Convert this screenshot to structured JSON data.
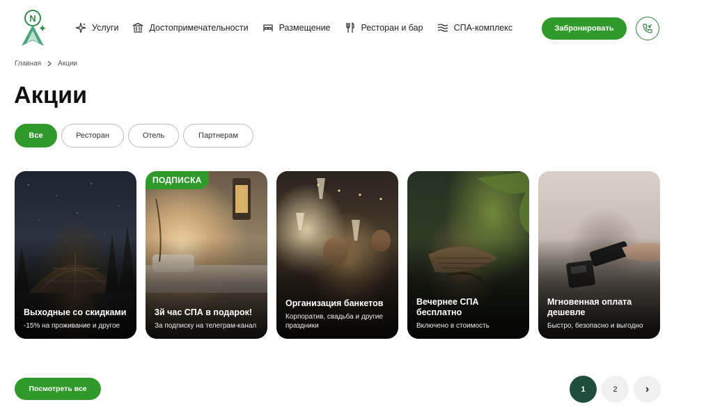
{
  "header": {
    "logo_letter": "N",
    "nav": [
      {
        "label": "Услуги",
        "icon": "sparkle-icon"
      },
      {
        "label": "Достопримечательности",
        "icon": "museum-icon"
      },
      {
        "label": "Размещение",
        "icon": "bed-icon"
      },
      {
        "label": "Ресторан и бар",
        "icon": "cutlery-icon"
      },
      {
        "label": "СПА-комплекс",
        "icon": "waves-icon"
      }
    ],
    "book_label": "Забронировать",
    "phone_icon": "phone-callback-icon"
  },
  "breadcrumb": {
    "home": "Главная",
    "current": "Акции"
  },
  "page_title": "Акции",
  "filters": [
    {
      "label": "Все",
      "active": true
    },
    {
      "label": "Ресторан",
      "active": false
    },
    {
      "label": "Отель",
      "active": false
    },
    {
      "label": "Партнерам",
      "active": false
    }
  ],
  "cards": [
    {
      "title": "Выходные со скидками",
      "desc": "-15% на проживание и другое",
      "badge": ""
    },
    {
      "title": "3й час СПА в подарок!",
      "desc": "За подписку на телеграм-канал",
      "badge": "ПОДПИСКА"
    },
    {
      "title": "Организация банкетов",
      "desc": "Корпоратив, свадьба и другие праздники",
      "badge": ""
    },
    {
      "title": "Вечернее СПА бесплатно",
      "desc": "Включено в стоимость",
      "badge": ""
    },
    {
      "title": "Мгновенная оплата дешевле",
      "desc": "Быстро, безопасно и выгодно",
      "badge": ""
    }
  ],
  "see_all_label": "Посмотреть все",
  "pagination": {
    "pages": [
      "1",
      "2"
    ],
    "current": "1",
    "next_glyph": "›"
  },
  "colors": {
    "accent": "#2f9a2a",
    "pager_active": "#1f4f3a"
  }
}
